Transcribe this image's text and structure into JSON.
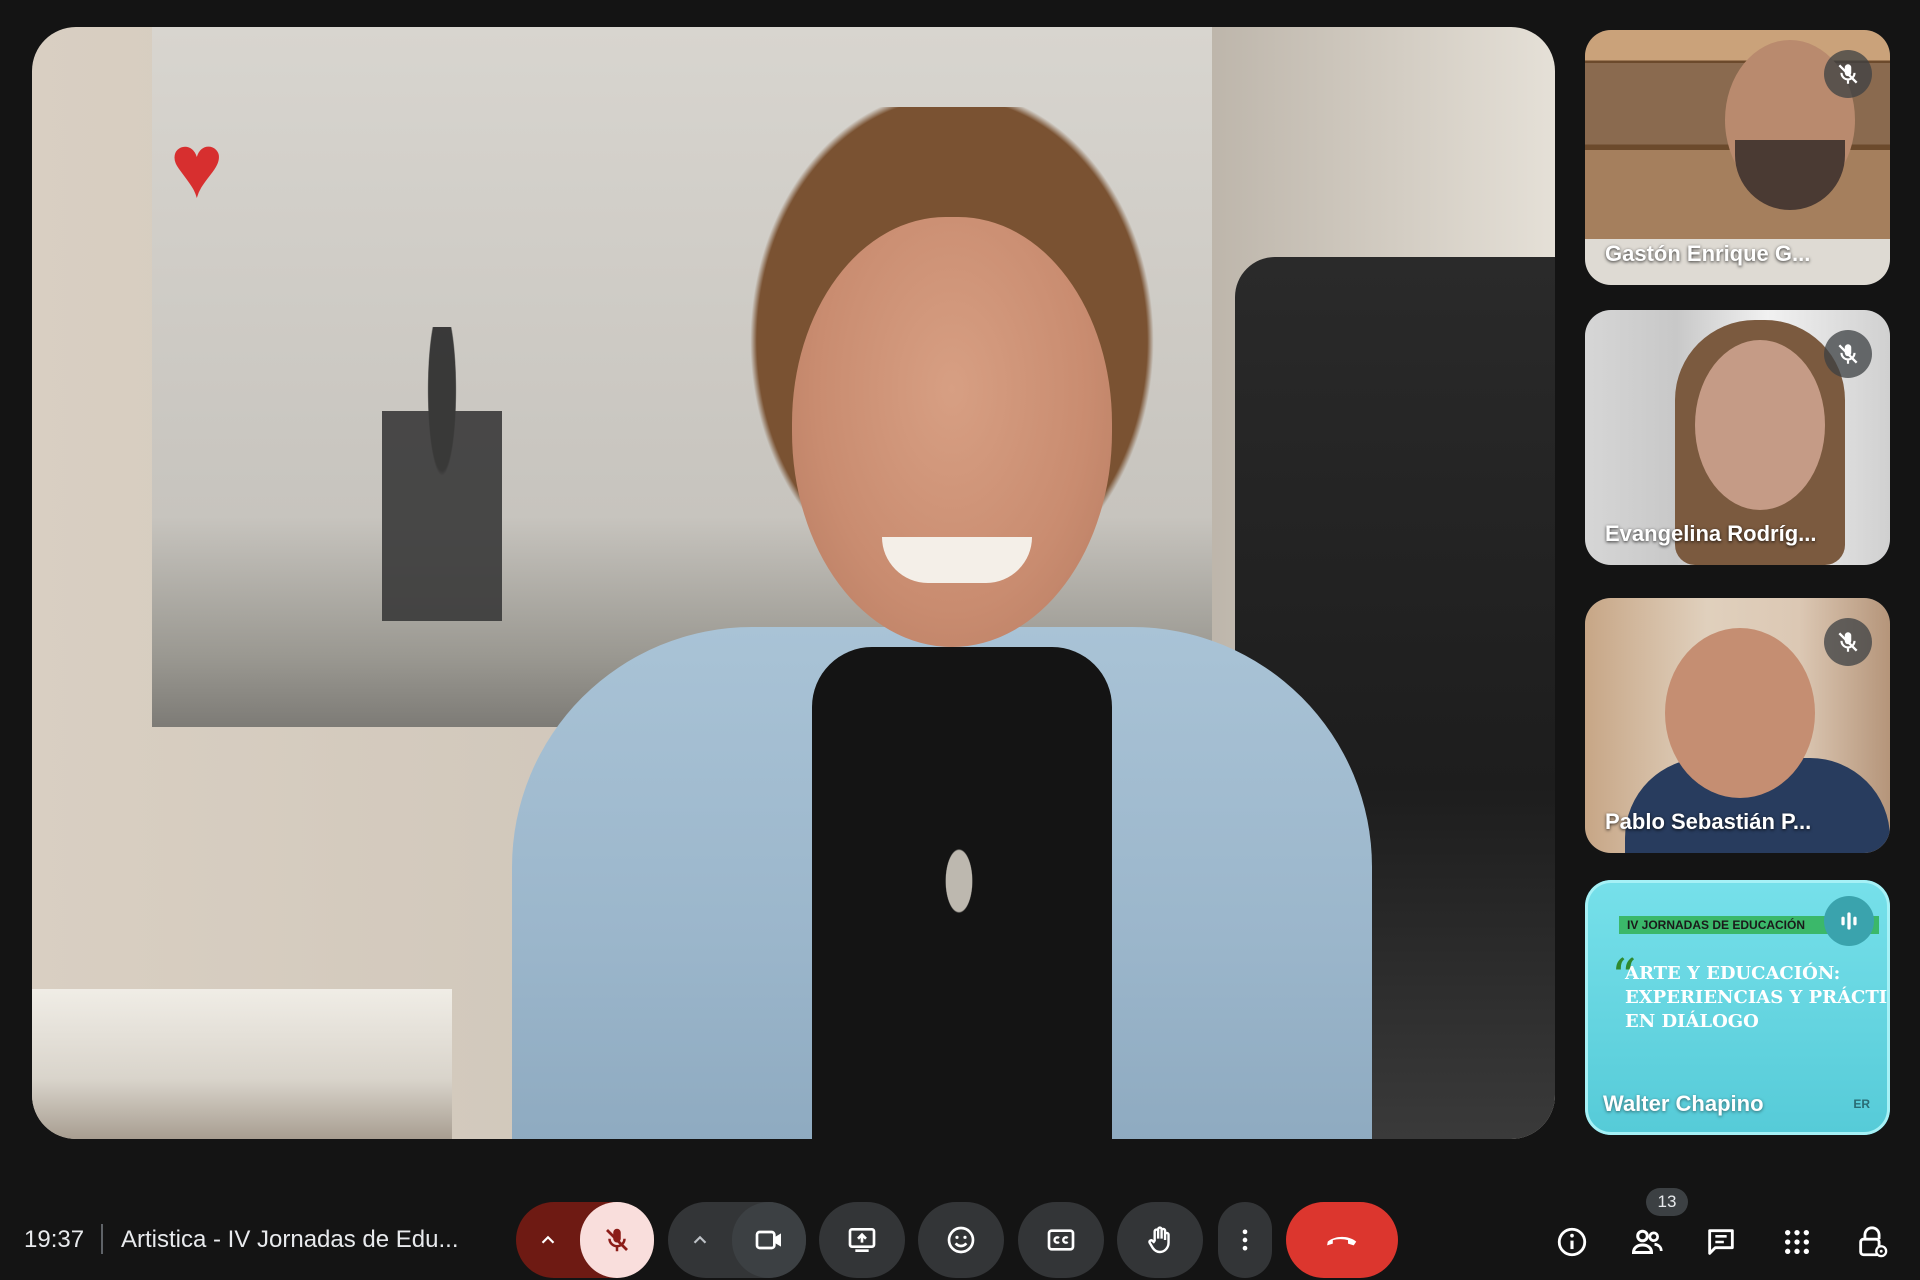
{
  "meeting": {
    "time": "19:37",
    "title": "Artistica - IV Jornadas de Edu...",
    "participant_count": "13"
  },
  "main_speaker": {
    "description_icon": "video-feed"
  },
  "participants": [
    {
      "name": "Gastón Enrique G...",
      "muted": true
    },
    {
      "name": "Evangelina Rodríg...",
      "muted": true
    },
    {
      "name": "Pablo Sebastián P...",
      "muted": true
    },
    {
      "name": "Walter Chapino",
      "muted": false,
      "speaking": true
    }
  ],
  "presentation_tile": {
    "banner": "IV JORNADAS DE EDUCACIÓN",
    "title": "ARTE Y EDUCACIÓN:\nEXPERIENCIAS Y PRÁCTI\nEN DIÁLOGO",
    "logo": "ER"
  },
  "controls": {
    "mic": {
      "state": "off",
      "icon": "mic-off-icon"
    },
    "camera": {
      "state": "on",
      "icon": "camera-icon"
    },
    "present": "present-screen-icon",
    "emoji": "emoji-icon",
    "captions": "captions-icon",
    "raise_hand": "raise-hand-icon",
    "more": "more-vert-icon",
    "leave": "leave-call-icon"
  },
  "right_icons": [
    "info-icon",
    "people-icon",
    "chat-icon",
    "apps-icon",
    "host-controls-icon"
  ],
  "colors": {
    "background": "#141414",
    "control_bg": "#333537",
    "mic_off_bg": "#f9dedc",
    "mic_group_bg": "#6e1a13",
    "leave_red": "#dc362e",
    "text": "#e8eaed"
  }
}
